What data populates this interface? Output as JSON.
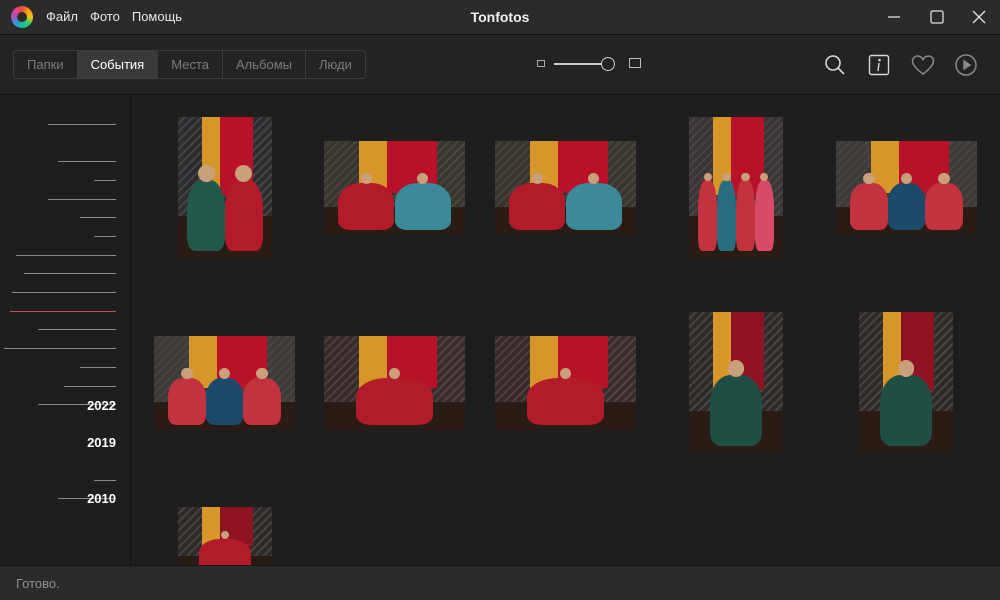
{
  "window": {
    "title": "Tonfotos",
    "menu": [
      "Файл",
      "Фото",
      "Помощь"
    ]
  },
  "toolbar": {
    "tabs": [
      {
        "label": "Папки",
        "active": false
      },
      {
        "label": "События",
        "active": true
      },
      {
        "label": "Места",
        "active": false
      },
      {
        "label": "Альбомы",
        "active": false
      },
      {
        "label": "Люди",
        "active": false
      }
    ],
    "zoom_level": 0.9,
    "actions": [
      "search-icon",
      "info-icon",
      "heart-icon",
      "play-icon"
    ]
  },
  "timeline": {
    "years": [
      "2022",
      "2019",
      "2010"
    ]
  },
  "photos": [
    {
      "orientation": "portrait",
      "subject": "two women in saris, red curtains"
    },
    {
      "orientation": "landscape",
      "subject": "two women on sofa, red and teal dresses"
    },
    {
      "orientation": "landscape",
      "subject": "two women on sofa, red and teal dresses"
    },
    {
      "orientation": "portrait",
      "subject": "group of women in colorful dresses"
    },
    {
      "orientation": "landscape",
      "subject": "group of women with flowers"
    },
    {
      "orientation": "landscape",
      "subject": "group of women with flowers"
    },
    {
      "orientation": "landscape",
      "subject": "woman in red dress seated among roses"
    },
    {
      "orientation": "landscape",
      "subject": "woman in red dress seated among roses"
    },
    {
      "orientation": "portrait",
      "subject": "woman in green and gold sari holding red flowers"
    },
    {
      "orientation": "portrait",
      "subject": "woman in green and gold sari holding red flowers"
    },
    {
      "orientation": "portrait",
      "subject": "woman under red curtains"
    }
  ],
  "colors": {
    "accent_red": "#c0504d",
    "curtain_red": "#b8122a",
    "curtain_gold": "#d6962a"
  },
  "status": {
    "text": "Готово."
  }
}
